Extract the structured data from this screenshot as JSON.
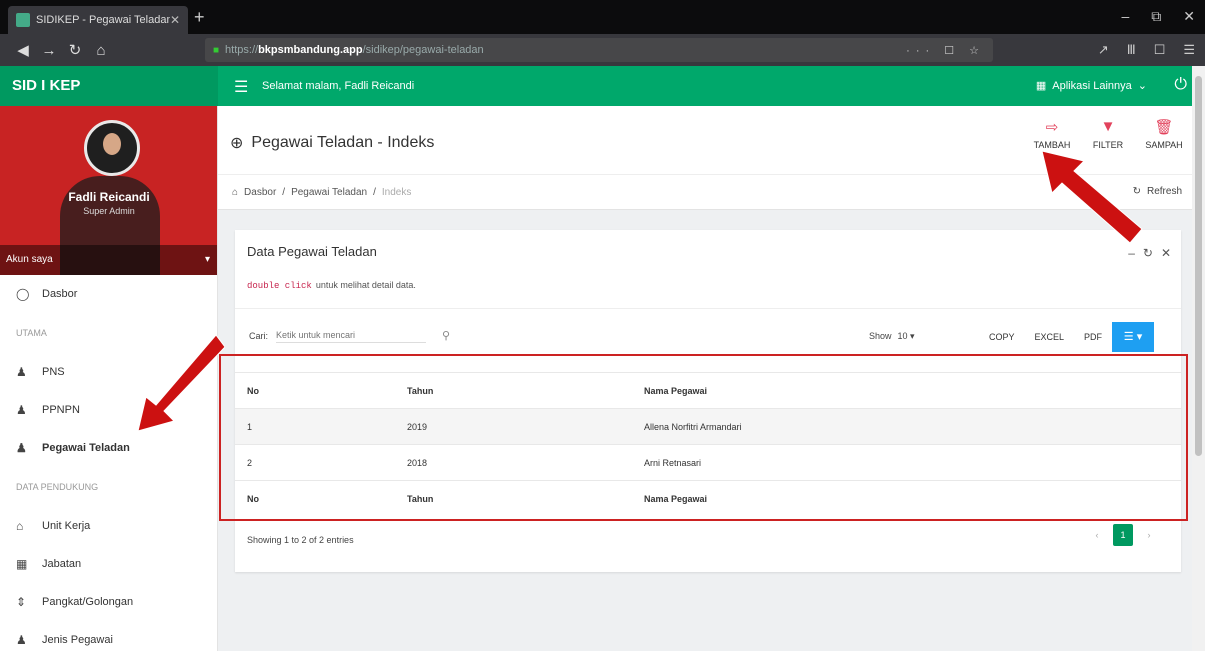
{
  "browser": {
    "tab_title": "SIDIKEP - Pegawai Teladan",
    "tab_close": "✕",
    "new_tab": "+",
    "url_host": "bkpsmbandung.app",
    "url_prefix": "https://",
    "url_path": "/sidikep/pegawai-teladan",
    "url_actions": "··· ☐ ☆",
    "window_controls": [
      "–",
      "⧉",
      "✕"
    ],
    "toolbar_icons": [
      "↗",
      "Ⅲ",
      "☐",
      "☰"
    ]
  },
  "app": {
    "brand": "SID I KEP",
    "greeting": "Selamat malam, Fadli Reicandi",
    "other_apps": "Aplikasi Lainnya",
    "power": "⏻"
  },
  "profile": {
    "name": "Fadli Reicandi",
    "role": "Super Admin",
    "account": "Akun saya"
  },
  "sidebar": {
    "items": [
      {
        "label": "Dasbor",
        "icon": "◯"
      },
      {
        "header": "UTAMA"
      },
      {
        "label": "PNS",
        "icon": "♟"
      },
      {
        "label": "PPNPN",
        "icon": "♟"
      },
      {
        "label": "Pegawai Teladan",
        "icon": "♟"
      },
      {
        "header": "DATA PENDUKUNG"
      },
      {
        "label": "Unit Kerja",
        "icon": "⌂"
      },
      {
        "label": "Jabatan",
        "icon": "▦"
      },
      {
        "label": "Pangkat/Golongan",
        "icon": "⇕"
      },
      {
        "label": "Jenis Pegawai",
        "icon": "♟"
      }
    ]
  },
  "page": {
    "title": "Pegawai Teladan - Indeks",
    "title_icon": "⊕",
    "actions": [
      {
        "label": "TAMBAH",
        "icon": "⇨"
      },
      {
        "label": "FILTER",
        "icon": "▼"
      },
      {
        "label": "SAMPAH",
        "icon": "🗑"
      }
    ],
    "breadcrumb": [
      "Dasbor",
      "Pegawai Teladan",
      "Indeks"
    ],
    "refresh": "Refresh"
  },
  "card": {
    "title": "Data Pegawai Teladan",
    "hint_code": "double click",
    "hint_text": "untuk melihat detail data.",
    "tools": [
      "–",
      "↻",
      "✕"
    ],
    "search_label": "Cari:",
    "search_placeholder": "Ketik untuk mencari",
    "show_label": "Show",
    "show_value": "10",
    "export_buttons": [
      "COPY",
      "EXCEL",
      "PDF"
    ],
    "columns": [
      "No",
      "Tahun",
      "Nama Pegawai"
    ],
    "rows": [
      {
        "no": "1",
        "tahun": "2019",
        "nama": "Allena Norfitri Armandari"
      },
      {
        "no": "2",
        "tahun": "2018",
        "nama": "Arni Retnasari"
      }
    ],
    "footer_info": "Showing 1 to 2 of 2 entries",
    "pager": {
      "prev": "‹",
      "current": "1",
      "next": "›"
    }
  },
  "colors": {
    "header_green": "#00a86b",
    "brand_green": "#009960",
    "profile_red": "#c82323",
    "action_pink": "#e2425c",
    "annotation_red": "#c22"
  }
}
